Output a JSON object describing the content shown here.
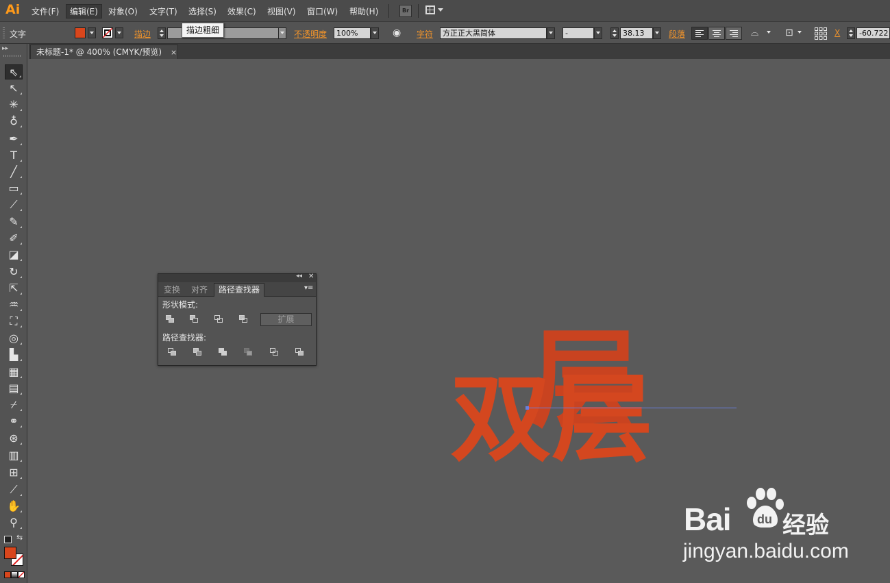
{
  "app": {
    "logo": "Ai"
  },
  "menu": {
    "items": [
      "文件(F)",
      "编辑(E)",
      "对象(O)",
      "文字(T)",
      "选择(S)",
      "效果(C)",
      "视图(V)",
      "窗口(W)",
      "帮助(H)"
    ],
    "bridge_label": "Br"
  },
  "control_bar": {
    "mode_label": "文字",
    "fill_color": "#d9461c",
    "stroke_label": "描边",
    "stroke_tooltip": "描边粗细",
    "opacity_label": "不透明度",
    "opacity_value": "100%",
    "char_label": "字符",
    "font_family": "方正正大黑简体",
    "font_style": "-",
    "font_size": "38.13",
    "paragraph_label": "段落",
    "x_label": "X",
    "x_value": "-60.722"
  },
  "document": {
    "tab_title": "未标题-1* @ 400% (CMYK/预览)",
    "tab_close": "×"
  },
  "pathfinder_panel": {
    "tabs": [
      "变换",
      "对齐",
      "路径查找器"
    ],
    "active_tab": 2,
    "shape_modes_label": "形状模式:",
    "expand_label": "扩展",
    "pathfinders_label": "路径查找器:"
  },
  "artwork": {
    "text_back": "层",
    "text_front": "双层",
    "color": "#cc4420"
  },
  "watermark": {
    "brand": "Bai",
    "brand_cn": "经验",
    "url": "jingyan.baidu.com"
  }
}
